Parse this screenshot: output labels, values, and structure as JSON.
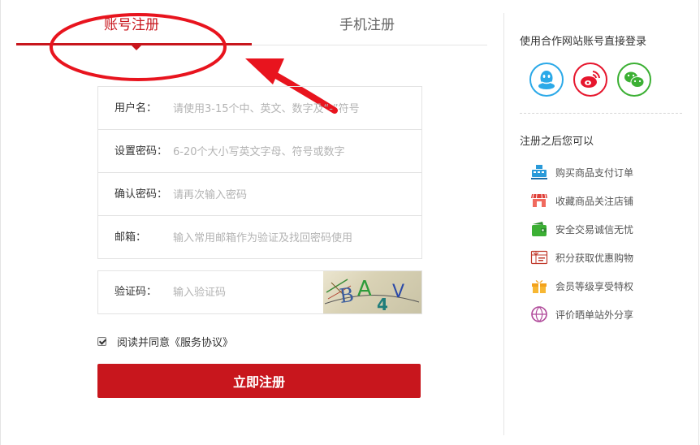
{
  "tabs": [
    {
      "label": "账号注册",
      "active": true
    },
    {
      "label": "手机注册",
      "active": false
    }
  ],
  "form": {
    "username": {
      "label": "用户名：",
      "placeholder": "请使用3-15个中、英文、数字及“-”符号"
    },
    "password": {
      "label": "设置密码：",
      "placeholder": "6-20个大小写英文字母、符号或数字"
    },
    "confirm": {
      "label": "确认密码：",
      "placeholder": "请再次输入密码"
    },
    "email": {
      "label": "邮箱：",
      "placeholder": "输入常用邮箱作为验证及找回密码使用"
    },
    "captcha": {
      "label": "验证码：",
      "placeholder": "输入验证码",
      "image_text": [
        "B",
        "A",
        "4",
        "V"
      ]
    },
    "agree": {
      "checked": true,
      "text": "阅读并同意《服务协议》"
    },
    "submit_label": "立即注册"
  },
  "side": {
    "login_title": "使用合作网站账号直接登录",
    "social": [
      {
        "name": "qq-icon",
        "color": "#2ba9e8"
      },
      {
        "name": "weibo-icon",
        "color": "#e6162d"
      },
      {
        "name": "wechat-icon",
        "color": "#3cb034"
      }
    ],
    "benefits_title": "注册之后您可以",
    "benefits": [
      {
        "icon": "cash-register-icon",
        "text": "购买商品支付订单"
      },
      {
        "icon": "store-icon",
        "text": "收藏商品关注店铺"
      },
      {
        "icon": "wallet-icon",
        "text": "安全交易诚信无忧"
      },
      {
        "icon": "gift-card-icon",
        "text": "积分获取优惠购物"
      },
      {
        "icon": "gift-box-icon",
        "text": "会员等级享受特权"
      },
      {
        "icon": "share-icon",
        "text": "评价晒单站外分享"
      }
    ]
  },
  "colors": {
    "brand_red": "#c8161d",
    "annotation_red": "#e8141e",
    "qq": "#2ba9e8",
    "weibo": "#e6162d",
    "wechat": "#3cb034"
  }
}
